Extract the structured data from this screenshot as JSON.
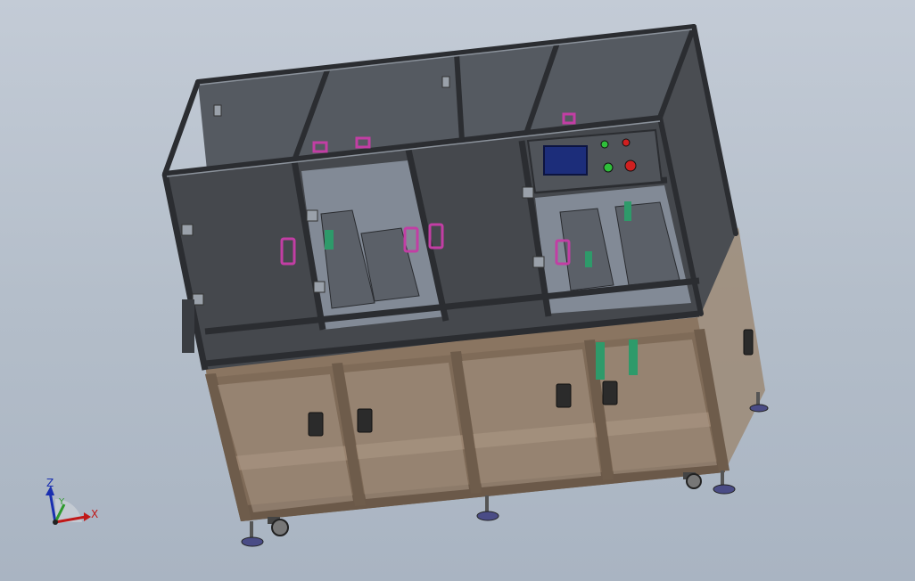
{
  "viewport": {
    "background_top": "#c3cbd6",
    "background_bottom": "#a9b4c2"
  },
  "colors": {
    "frame_dark": "#3c3f44",
    "panel_dark": "#4a4d52",
    "base_brown": "#7f6b58",
    "base_light": "#9c8a76",
    "glass": "#8d97a3",
    "handle_magenta": "#c23ea4",
    "hmi_screen": "#1c2d7a",
    "light_green": "#2fbf3a",
    "light_red": "#d02020",
    "foot_blue": "#4a4c86",
    "green_part": "#2e9a6a"
  },
  "axis_triad": {
    "x_label": "X",
    "y_label": "Y",
    "z_label": "Z",
    "x_color": "#c01818",
    "y_color": "#2e9a2e",
    "z_color": "#1a2fb0"
  }
}
